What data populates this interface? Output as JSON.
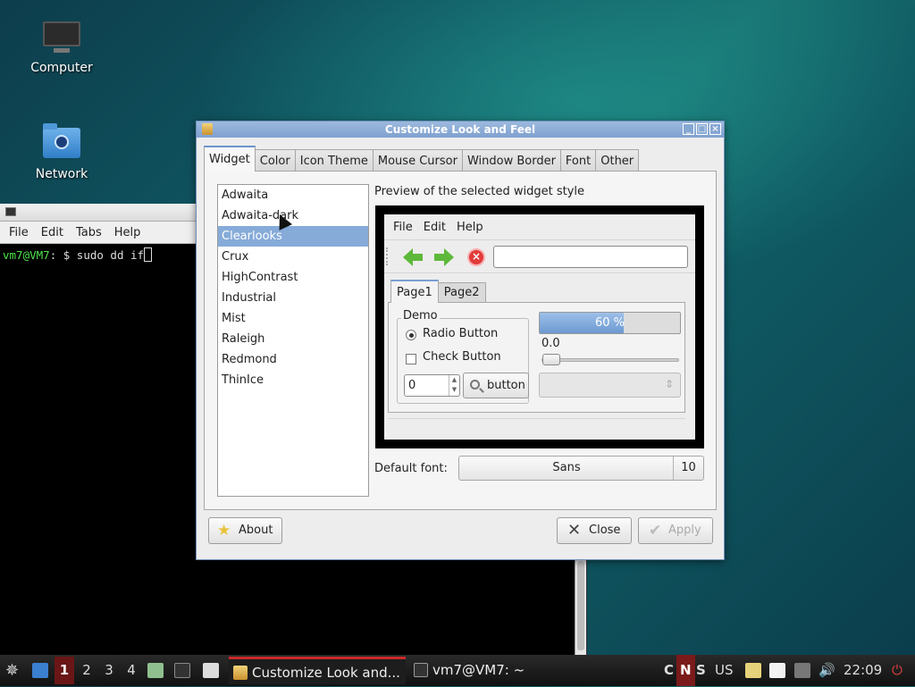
{
  "desktop": {
    "icons": [
      {
        "label": "Computer",
        "icon": "computer-icon"
      },
      {
        "label": "Network",
        "icon": "network-folder-icon"
      }
    ]
  },
  "terminal": {
    "menu": [
      "File",
      "Edit",
      "Tabs",
      "Help"
    ],
    "prompt_user": "vm7@VM7",
    "prompt_rest": ": $ sudo dd if"
  },
  "dialog": {
    "title": "Customize Look and Feel",
    "tabs": [
      "Widget",
      "Color",
      "Icon Theme",
      "Mouse Cursor",
      "Window Border",
      "Font",
      "Other"
    ],
    "active_tab": "Widget",
    "themes": [
      "Adwaita",
      "Adwaita-dark",
      "Clearlooks",
      "Crux",
      "HighContrast",
      "Industrial",
      "Mist",
      "Raleigh",
      "Redmond",
      "ThinIce"
    ],
    "selected_theme": "Clearlooks",
    "preview_label": "Preview of the selected widget style",
    "preview": {
      "menu": [
        "File",
        "Edit",
        "Help"
      ],
      "tabs": [
        "Page1",
        "Page2"
      ],
      "demo_label": "Demo",
      "radio_label": "Radio Button",
      "check_label": "Check Button",
      "spin_value": "0",
      "button_label": "button",
      "progress_text": "60 %",
      "progress_fraction": 0.6,
      "slider_value": "0.0"
    },
    "default_font_label": "Default font:",
    "font_name": "Sans",
    "font_size": "10",
    "about_label": "About",
    "close_label": "Close",
    "apply_label": "Apply"
  },
  "taskbar": {
    "workspaces": [
      "1",
      "2",
      "3",
      "4"
    ],
    "active_workspace": "1",
    "tasks": [
      "Customize Look and...",
      "vm7@VM7: ~"
    ],
    "indicators": [
      "C",
      "N",
      "S"
    ],
    "keyboard_layout": "US",
    "clock": "22:09"
  }
}
